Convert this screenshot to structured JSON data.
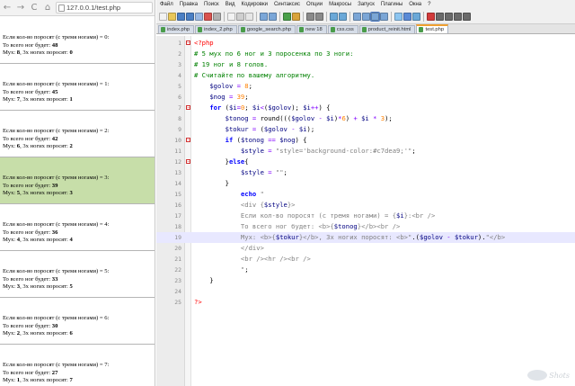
{
  "browser": {
    "nav": {
      "back": "←",
      "forward": "→",
      "reload": "C",
      "home": "⌂"
    },
    "url": "127.0.0.1/test.php",
    "records": [
      {
        "line1": "Если кол-во поросят (с тремя ногами) = 0:",
        "line2_label": "То всего ног будет: ",
        "total": "48",
        "line3_label": "Мух: ",
        "mux": "8",
        "line3_mid": ", 3х ногих поросят: ",
        "pigs": "0",
        "highlighted": false
      },
      {
        "line1": "Если кол-во поросят (с тремя ногами) = 1:",
        "line2_label": "То всего ног будет: ",
        "total": "45",
        "line3_label": "Мух: ",
        "mux": "7",
        "line3_mid": ", 3х ногих поросят: ",
        "pigs": "1",
        "highlighted": false
      },
      {
        "line1": "Если кол-во поросят (с тремя ногами) = 2:",
        "line2_label": "То всего ног будет: ",
        "total": "42",
        "line3_label": "Мух: ",
        "mux": "6",
        "line3_mid": ", 3х ногих поросят: ",
        "pigs": "2",
        "highlighted": false
      },
      {
        "line1": "Если кол-во поросят (с тремя ногами) = 3:",
        "line2_label": "То всего ног будет: ",
        "total": "39",
        "line3_label": "Мух: ",
        "mux": "5",
        "line3_mid": ", 3х ногих поросят: ",
        "pigs": "3",
        "highlighted": true
      },
      {
        "line1": "Если кол-во поросят (с тремя ногами) = 4:",
        "line2_label": "То всего ног будет: ",
        "total": "36",
        "line3_label": "Мух: ",
        "mux": "4",
        "line3_mid": ", 3х ногих поросят: ",
        "pigs": "4",
        "highlighted": false
      },
      {
        "line1": "Если кол-во поросят (с тремя ногами) = 5:",
        "line2_label": "То всего ног будет: ",
        "total": "33",
        "line3_label": "Мух: ",
        "mux": "3",
        "line3_mid": ", 3х ногих поросят: ",
        "pigs": "5",
        "highlighted": false
      },
      {
        "line1": "Если кол-во поросят (с тремя ногами) = 6:",
        "line2_label": "То всего ног будет: ",
        "total": "30",
        "line3_label": "Мух: ",
        "mux": "2",
        "line3_mid": ", 3х ногих поросят: ",
        "pigs": "6",
        "highlighted": false
      },
      {
        "line1": "Если кол-во поросят (с тремя ногами) = 7:",
        "line2_label": "То всего ног будет: ",
        "total": "27",
        "line3_label": "Мух: ",
        "mux": "1",
        "line3_mid": ", 3х ногих поросят: ",
        "pigs": "7",
        "highlighted": false
      }
    ],
    "highlight_color": "#c7dea9"
  },
  "editor": {
    "menu": [
      "Файл",
      "Правка",
      "Поиск",
      "Вид",
      "Кодировки",
      "Синтаксис",
      "Опции",
      "Макросы",
      "Запуск",
      "Плагины",
      "Окна",
      "?"
    ],
    "tabs": [
      {
        "label": "index.php",
        "active": false
      },
      {
        "label": "index_2.php",
        "active": false
      },
      {
        "label": "google_search.php",
        "active": false
      },
      {
        "label": "new 18",
        "active": false
      },
      {
        "label": "css.css",
        "active": false
      },
      {
        "label": "product_reinit.html",
        "active": false
      },
      {
        "label": "test.php",
        "active": true
      }
    ],
    "current_line": 19,
    "lines": [
      {
        "n": 1,
        "fold": "minus",
        "html": "<span class=\"php\">&lt;?php</span>"
      },
      {
        "n": 2,
        "fold": "",
        "html": "<span class=\"cm\"># 5 мух по 6 ног и 3 поросенка по 3 ноги:</span>"
      },
      {
        "n": 3,
        "fold": "",
        "html": "<span class=\"cm\"># 19 ног и 8 голов.</span>"
      },
      {
        "n": 4,
        "fold": "",
        "html": "<span class=\"cm\"># Считайте по вашему алгоритму.</span>"
      },
      {
        "n": 5,
        "fold": "",
        "html": "    <span class=\"var\">$golov</span> <span class=\"op\">=</span> <span class=\"num\">8</span>;"
      },
      {
        "n": 6,
        "fold": "",
        "html": "    <span class=\"var\">$nog</span> <span class=\"op\">=</span> <span class=\"num\">39</span>;"
      },
      {
        "n": 7,
        "fold": "minus",
        "html": "    <span class=\"kw\">for</span> (<span class=\"var\">$i</span><span class=\"op\">=</span><span class=\"num\">0</span>; <span class=\"var\">$i</span><span class=\"op\">&lt;</span>(<span class=\"var\">$golov</span>); <span class=\"var\">$i</span><span class=\"op\">++</span>) {"
      },
      {
        "n": 8,
        "fold": "",
        "html": "        <span class=\"var\">$tonog</span> <span class=\"op\">=</span> round(((<span class=\"var\">$golov</span> <span class=\"op\">-</span> <span class=\"var\">$i</span>)<span class=\"op\">*</span><span class=\"num\">6</span>) <span class=\"op\">+</span> <span class=\"var\">$i</span> <span class=\"op\">*</span> <span class=\"num\">3</span>);"
      },
      {
        "n": 9,
        "fold": "",
        "html": "        <span class=\"var\">$tokur</span> <span class=\"op\">=</span> (<span class=\"var\">$golov</span> <span class=\"op\">-</span> <span class=\"var\">$i</span>);"
      },
      {
        "n": 10,
        "fold": "minus",
        "html": "        <span class=\"kw\">if</span> (<span class=\"var\">$tonog</span> <span class=\"op\">==</span> <span class=\"var\">$nog</span>) {"
      },
      {
        "n": 11,
        "fold": "",
        "html": "            <span class=\"var\">$style</span> <span class=\"op\">=</span> <span class=\"str\">\"style='background-color:#c7dea9;'\"</span>;"
      },
      {
        "n": 12,
        "fold": "minus",
        "html": "        }<span class=\"kw\">else</span>{"
      },
      {
        "n": 13,
        "fold": "",
        "html": "            <span class=\"var\">$style</span> <span class=\"op\">=</span> <span class=\"str\">\"\"</span>;"
      },
      {
        "n": 14,
        "fold": "",
        "html": "        }"
      },
      {
        "n": 15,
        "fold": "",
        "html": "            <span class=\"kw\">echo</span> <span class=\"str\">\"</span>"
      },
      {
        "n": 16,
        "fold": "",
        "html": "<span class=\"str\">            &lt;div {</span><span class=\"var\">$style</span><span class=\"str\">}&gt;</span>"
      },
      {
        "n": 17,
        "fold": "",
        "html": "<span class=\"str\">            Если кол-во поросят (с тремя ногами) = {</span><span class=\"var\">$i</span><span class=\"str\">}:&lt;br /&gt;</span>"
      },
      {
        "n": 18,
        "fold": "",
        "html": "<span class=\"str\">            То всего ног будет: &lt;b&gt;{</span><span class=\"var\">$tonog</span><span class=\"str\">}&lt;/b&gt;&lt;br /&gt;</span>"
      },
      {
        "n": 19,
        "fold": "",
        "html": "<span class=\"str\">            Мух: &lt;b&gt;{</span><span class=\"var\">$tokur</span><span class=\"str\">}&lt;/b&gt;, 3х ногих поросят: &lt;b&gt;\"</span>.(<span class=\"var\">$golov</span> <span class=\"op\">-</span> <span class=\"var\">$tokur</span>).<span class=\"str\">\"&lt;/b&gt;</span>"
      },
      {
        "n": 20,
        "fold": "",
        "html": "<span class=\"str\">            &lt;/div&gt;</span>"
      },
      {
        "n": 21,
        "fold": "",
        "html": "<span class=\"str\">            &lt;br /&gt;&lt;hr /&gt;&lt;br /&gt;</span>"
      },
      {
        "n": 22,
        "fold": "",
        "html": "<span class=\"str\">            \"</span>;"
      },
      {
        "n": 23,
        "fold": "",
        "html": "    }"
      },
      {
        "n": 24,
        "fold": "",
        "html": ""
      },
      {
        "n": 25,
        "fold": "",
        "html": "<span class=\"php\">?&gt;</span>"
      }
    ]
  },
  "watermark": {
    "text": "Shots"
  }
}
